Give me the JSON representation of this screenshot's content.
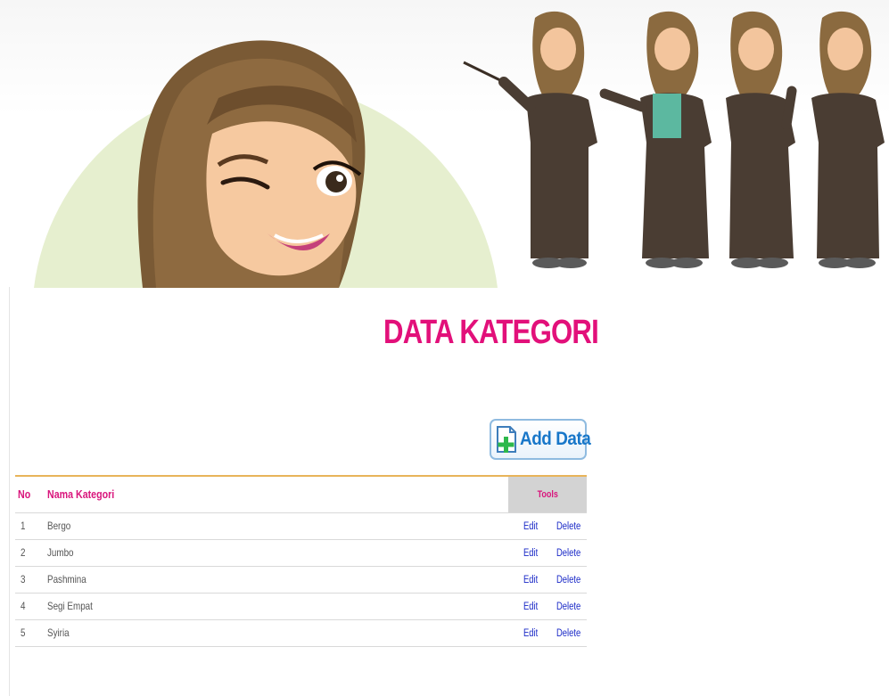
{
  "page": {
    "title": "DATA KATEGORI"
  },
  "toolbar": {
    "add_label": "Add Data"
  },
  "table": {
    "headers": {
      "no": "No",
      "name": "Nama Kategori",
      "tools": "Tools"
    },
    "rows": [
      {
        "no": "1",
        "name": "Bergo",
        "edit": "Edit",
        "delete": "Delete"
      },
      {
        "no": "2",
        "name": "Jumbo",
        "edit": "Edit",
        "delete": "Delete"
      },
      {
        "no": "3",
        "name": "Pashmina",
        "edit": "Edit",
        "delete": "Delete"
      },
      {
        "no": "4",
        "name": "Segi Empat",
        "edit": "Edit",
        "delete": "Delete"
      },
      {
        "no": "5",
        "name": "Syiria",
        "edit": "Edit",
        "delete": "Delete"
      }
    ]
  },
  "colors": {
    "title": "#e2107a",
    "header_text": "#d9157c",
    "link": "#1a29c7",
    "button_text": "#1877c9",
    "header_border": "#e8b45a"
  },
  "icons": {
    "add_button_icon": "add-document-icon"
  }
}
